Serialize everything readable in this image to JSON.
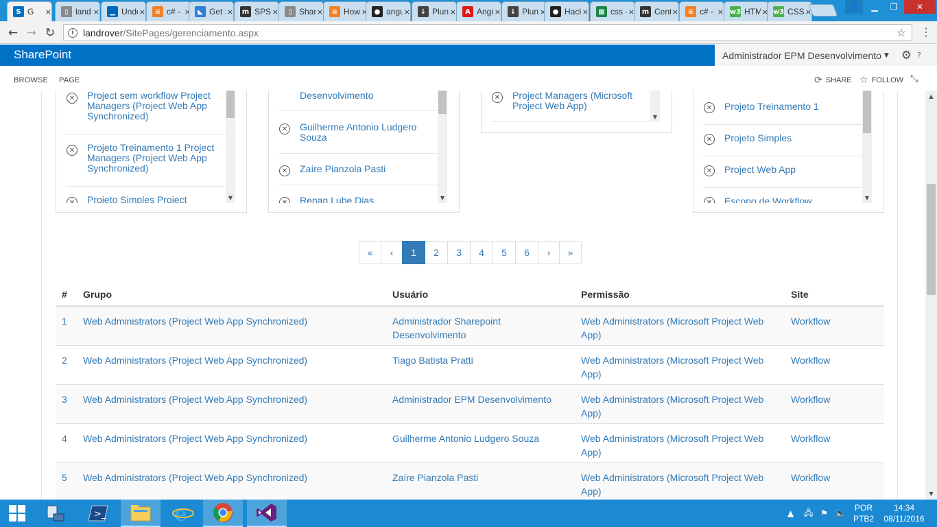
{
  "browser": {
    "tabs": [
      {
        "label": "G",
        "icon": "sharepoint-icon",
        "color": "#0072c6",
        "glyph": "S"
      },
      {
        "label": "land",
        "icon": "page-icon",
        "color": "#8a8a8a",
        "glyph": "▯"
      },
      {
        "label": "Unde",
        "icon": "msdn-icon",
        "color": "#0067b8",
        "glyph": "▁"
      },
      {
        "label": "c# - ",
        "icon": "stackoverflow-icon",
        "color": "#f48024",
        "glyph": "≡"
      },
      {
        "label": "Get S",
        "icon": "azure-icon",
        "color": "#2f7ed8",
        "glyph": "◣"
      },
      {
        "label": "SPSit",
        "icon": "msdn-m-icon",
        "color": "#333333",
        "glyph": "m"
      },
      {
        "label": "Shar",
        "icon": "page-icon",
        "color": "#8a8a8a",
        "glyph": "▯"
      },
      {
        "label": "How",
        "icon": "stackoverflow-icon",
        "color": "#f48024",
        "glyph": "≡"
      },
      {
        "label": "angu",
        "icon": "github-icon",
        "color": "#222222",
        "glyph": "●"
      },
      {
        "label": "Plunl",
        "icon": "plunker-icon",
        "color": "#444444",
        "glyph": "↓"
      },
      {
        "label": "Angu",
        "icon": "angular-icon",
        "color": "#dd1b16",
        "glyph": "A"
      },
      {
        "label": "Plunl",
        "icon": "plunker-icon",
        "color": "#444444",
        "glyph": "↓"
      },
      {
        "label": "Hack",
        "icon": "github-icon",
        "color": "#222222",
        "glyph": "●"
      },
      {
        "label": "css - ",
        "icon": "spreadsheet-icon",
        "color": "#1e8449",
        "glyph": "▦"
      },
      {
        "label": "Cent",
        "icon": "msdn-m-icon",
        "color": "#333333",
        "glyph": "m"
      },
      {
        "label": "c# - ",
        "icon": "stackoverflow-icon",
        "color": "#f48024",
        "glyph": "≡"
      },
      {
        "label": "HTM",
        "icon": "w3schools-icon",
        "color": "#4caf50",
        "glyph": "w3"
      },
      {
        "label": "CSS",
        "icon": "w3schools-icon",
        "color": "#4caf50",
        "glyph": "w3"
      }
    ],
    "url_host": "landrover",
    "url_path": "/SitePages/gerenciamento.aspx",
    "info_glyph": "i",
    "star_glyph": "☆"
  },
  "sharepoint": {
    "brand": "SharePoint",
    "user_name": "Administrador EPM Desenvolvimento",
    "ribbon_tabs": [
      "BROWSE",
      "PAGE"
    ],
    "share_label": "SHARE",
    "follow_label": "FOLLOW"
  },
  "panels": [
    {
      "items": [
        "Project sem workflow Project Managers (Project Web App Synchronized)",
        "Projeto Treinamento 1 Project Managers (Project Web App Synchronized)",
        "Projeto Simples Project"
      ]
    },
    {
      "items": [
        "Desenvolvimento",
        "Guilherme Antonio Ludgero Souza",
        "Zaíre Pianzola Pasti",
        "Renan Lube Dias"
      ]
    },
    {
      "items": [
        "Project Managers (Microsoft Project Web App)"
      ]
    },
    {
      "items": [
        "Projeto Treinamento 1",
        "Projeto Simples",
        "Project Web App",
        "Escopo de Workflow"
      ]
    }
  ],
  "pagination": {
    "first": "«",
    "prev": "‹",
    "pages": [
      "1",
      "2",
      "3",
      "4",
      "5",
      "6"
    ],
    "active": "1",
    "next": "›",
    "last": "»"
  },
  "table": {
    "headers": [
      "#",
      "Grupo",
      "Usuário",
      "Permissão",
      "Site"
    ],
    "rows": [
      [
        "1",
        "Web Administrators (Project Web App Synchronized)",
        "Administrador Sharepoint Desenvolvimento",
        "Web Administrators (Microsoft Project Web App)",
        "Workflow"
      ],
      [
        "2",
        "Web Administrators (Project Web App Synchronized)",
        "Tiago Batista Pratti",
        "Web Administrators (Microsoft Project Web App)",
        "Workflow"
      ],
      [
        "3",
        "Web Administrators (Project Web App Synchronized)",
        "Administrador EPM Desenvolvimento",
        "Web Administrators (Microsoft Project Web App)",
        "Workflow"
      ],
      [
        "4",
        "Web Administrators (Project Web App Synchronized)",
        "Guilherme Antonio Ludgero Souza",
        "Web Administrators (Microsoft Project Web App)",
        "Workflow"
      ],
      [
        "5",
        "Web Administrators (Project Web App Synchronized)",
        "Zaíre Pianzola Pasti",
        "Web Administrators (Microsoft Project Web App)",
        "Workflow"
      ]
    ]
  },
  "taskbar": {
    "language": "POR",
    "layout": "PTB2",
    "time": "14:34",
    "date": "08/11/2016",
    "apps": [
      "start-icon",
      "network-admin-icon",
      "powershell-icon",
      "file-explorer-icon",
      "internet-explorer-icon",
      "chrome-icon",
      "visual-studio-icon"
    ]
  }
}
